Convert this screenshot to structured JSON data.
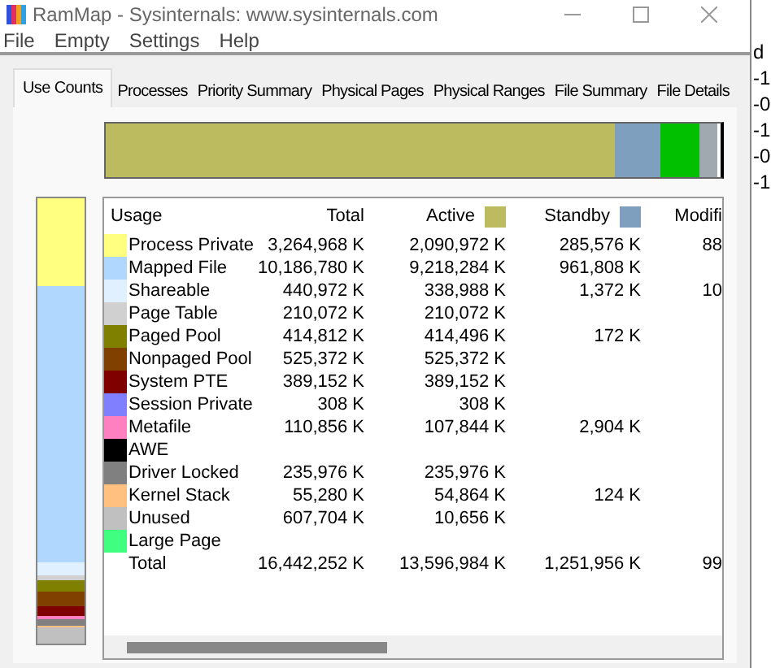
{
  "window": {
    "title": "RamMap - Sysinternals: www.sysinternals.com"
  },
  "menu": [
    "File",
    "Empty",
    "Settings",
    "Help"
  ],
  "tabs": [
    {
      "label": "Use Counts",
      "selected": true
    },
    {
      "label": "Processes",
      "selected": false
    },
    {
      "label": "Priority Summary",
      "selected": false
    },
    {
      "label": "Physical Pages",
      "selected": false
    },
    {
      "label": "Physical Ranges",
      "selected": false
    },
    {
      "label": "File Summary",
      "selected": false
    },
    {
      "label": "File Details",
      "selected": false
    }
  ],
  "usage_bar": {
    "segments": [
      {
        "color": "#bdbb5f"
      },
      {
        "color": "#7f9fbf"
      },
      {
        "color": "#00c000"
      },
      {
        "color": "#a0a8b0"
      }
    ]
  },
  "table": {
    "columns": [
      {
        "label": "Usage"
      },
      {
        "label": "Total"
      },
      {
        "label": "Active",
        "color": "#bdbb5f"
      },
      {
        "label": "Standby",
        "color": "#7f9fbf"
      },
      {
        "label": "Modifi"
      }
    ],
    "rows": [
      {
        "kind": "usage",
        "color": "#ffff80",
        "cells": [
          "Process Private",
          "3,264,968 K",
          "2,090,972 K",
          "285,576 K",
          "88"
        ]
      },
      {
        "kind": "usage",
        "color": "#b0d8ff",
        "cells": [
          "Mapped File",
          "10,186,780 K",
          "9,218,284 K",
          "961,808 K",
          ""
        ]
      },
      {
        "kind": "usage",
        "color": "#e0f0ff",
        "cells": [
          "Shareable",
          "440,972 K",
          "338,988 K",
          "1,372 K",
          "10"
        ]
      },
      {
        "kind": "usage",
        "color": "#d0d0d0",
        "cells": [
          "Page Table",
          "210,072 K",
          "210,072 K",
          "",
          ""
        ]
      },
      {
        "kind": "usage",
        "color": "#808000",
        "cells": [
          "Paged Pool",
          "414,812 K",
          "414,496 K",
          "172 K",
          ""
        ]
      },
      {
        "kind": "usage",
        "color": "#804000",
        "cells": [
          "Nonpaged Pool",
          "525,372 K",
          "525,372 K",
          "",
          ""
        ]
      },
      {
        "kind": "usage",
        "color": "#800000",
        "cells": [
          "System PTE",
          "389,152 K",
          "389,152 K",
          "",
          ""
        ]
      },
      {
        "kind": "usage",
        "color": "#8080ff",
        "cells": [
          "Session Private",
          "308 K",
          "308 K",
          "",
          ""
        ]
      },
      {
        "kind": "usage",
        "color": "#ff80c0",
        "cells": [
          "Metafile",
          "110,856 K",
          "107,844 K",
          "2,904 K",
          ""
        ]
      },
      {
        "kind": "usage",
        "color": "#000000",
        "cells": [
          "AWE",
          "",
          "",
          "",
          ""
        ]
      },
      {
        "kind": "usage",
        "color": "#808080",
        "cells": [
          "Driver Locked",
          "235,976 K",
          "235,976 K",
          "",
          ""
        ]
      },
      {
        "kind": "usage",
        "color": "#ffc080",
        "cells": [
          "Kernel Stack",
          "55,280 K",
          "54,864 K",
          "124 K",
          ""
        ]
      },
      {
        "kind": "usage",
        "color": "#c0c0c0",
        "cells": [
          "Unused",
          "607,704 K",
          "10,656 K",
          "",
          ""
        ]
      },
      {
        "kind": "usage",
        "color": "#40ff80",
        "cells": [
          "Large Page",
          "",
          "",
          "",
          ""
        ]
      },
      {
        "kind": "total",
        "cells": [
          "Total",
          "16,442,252 K",
          "13,596,984 K",
          "1,251,956 K",
          "99"
        ]
      }
    ]
  },
  "background_window": {
    "fragments": [
      "d",
      "-1",
      "-0",
      "-1",
      "-0",
      "-1"
    ]
  }
}
